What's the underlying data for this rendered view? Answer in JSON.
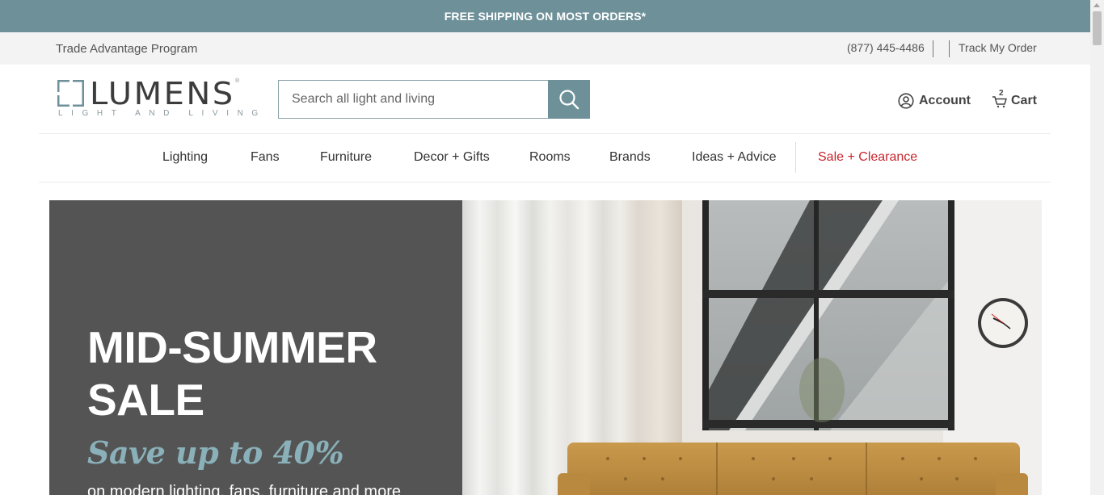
{
  "promo": {
    "text": "FREE SHIPPING ON MOST ORDERS*"
  },
  "util": {
    "trade": "Trade Advantage Program",
    "phone": "(877) 445-4486",
    "track": "Track My Order"
  },
  "logo": {
    "word": "LUMENS",
    "tagline": "LIGHT AND LIVING",
    "reg": "®",
    "icon": "lumens-square-mark-icon"
  },
  "search": {
    "placeholder": "Search all light and living",
    "value": "",
    "icon": "search-icon"
  },
  "account": {
    "label": "Account",
    "icon": "user-circle-icon"
  },
  "cart": {
    "label": "Cart",
    "count": "2",
    "icon": "cart-icon"
  },
  "nav": {
    "items": [
      {
        "label": "Lighting"
      },
      {
        "label": "Fans"
      },
      {
        "label": "Furniture"
      },
      {
        "label": "Decor + Gifts"
      },
      {
        "label": "Rooms"
      },
      {
        "label": "Brands"
      },
      {
        "label": "Ideas + Advice"
      },
      {
        "label": "Sale + Clearance"
      }
    ]
  },
  "hero": {
    "title_line1": "MID-SUMMER",
    "title_line2": "SALE",
    "save": "Save up to 40%",
    "subtitle": "on modern lighting, fans, furniture and more"
  },
  "colors": {
    "brand_teal": "#6e9199",
    "accent_teal": "#8ab1b9",
    "sale_red": "#c8262f",
    "hero_panel": "#545454"
  }
}
